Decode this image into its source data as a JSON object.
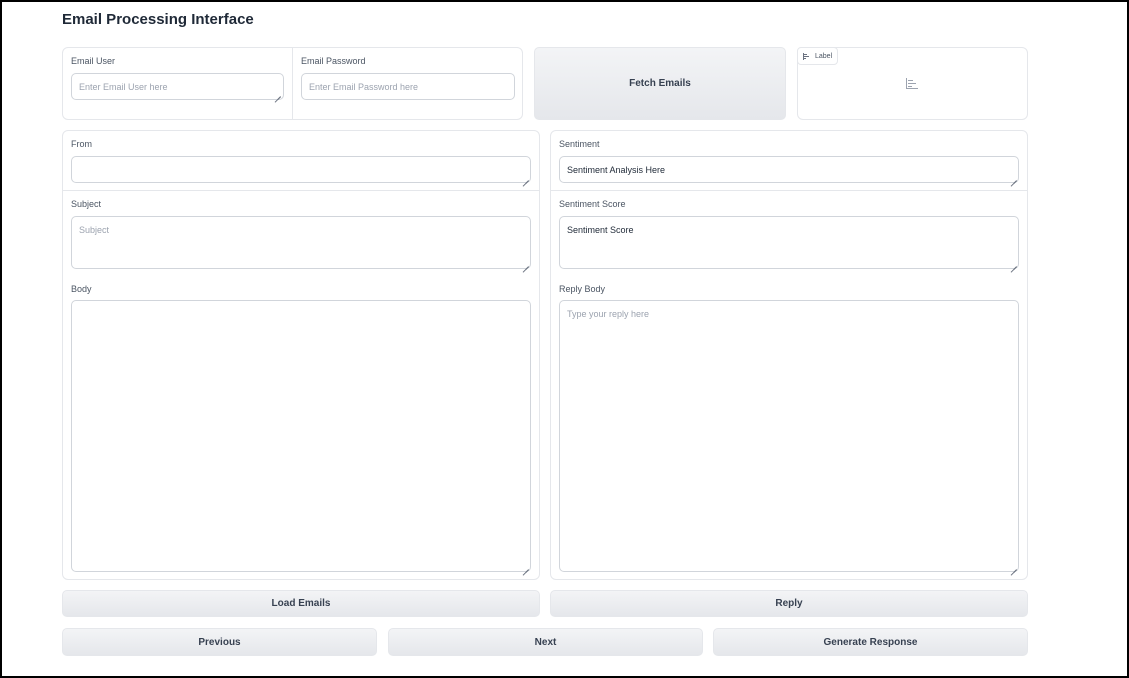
{
  "app": {
    "title": "Email Processing Interface"
  },
  "credentials": {
    "user_label": "Email User",
    "user_placeholder": "Enter Email User here",
    "password_label": "Email Password",
    "password_placeholder": "Enter Email Password here"
  },
  "actions": {
    "fetch_label": "Fetch Emails",
    "load_label": "Load Emails",
    "reply_label": "Reply",
    "previous_label": "Previous",
    "next_label": "Next",
    "generate_label": "Generate Response"
  },
  "label_output": {
    "tag": "Label"
  },
  "email": {
    "from_label": "From",
    "from_value": "",
    "subject_label": "Subject",
    "subject_placeholder": "Subject",
    "body_label": "Body",
    "body_value": ""
  },
  "analysis": {
    "sentiment_label": "Sentiment",
    "sentiment_value": "Sentiment Analysis Here",
    "score_label": "Sentiment Score",
    "score_value": "Sentiment Score",
    "reply_label": "Reply Body",
    "reply_placeholder": "Type your reply here"
  },
  "icons": {
    "label_tag_icon": "bar-chart-icon",
    "label_output_icon": "bar-chart-icon"
  }
}
